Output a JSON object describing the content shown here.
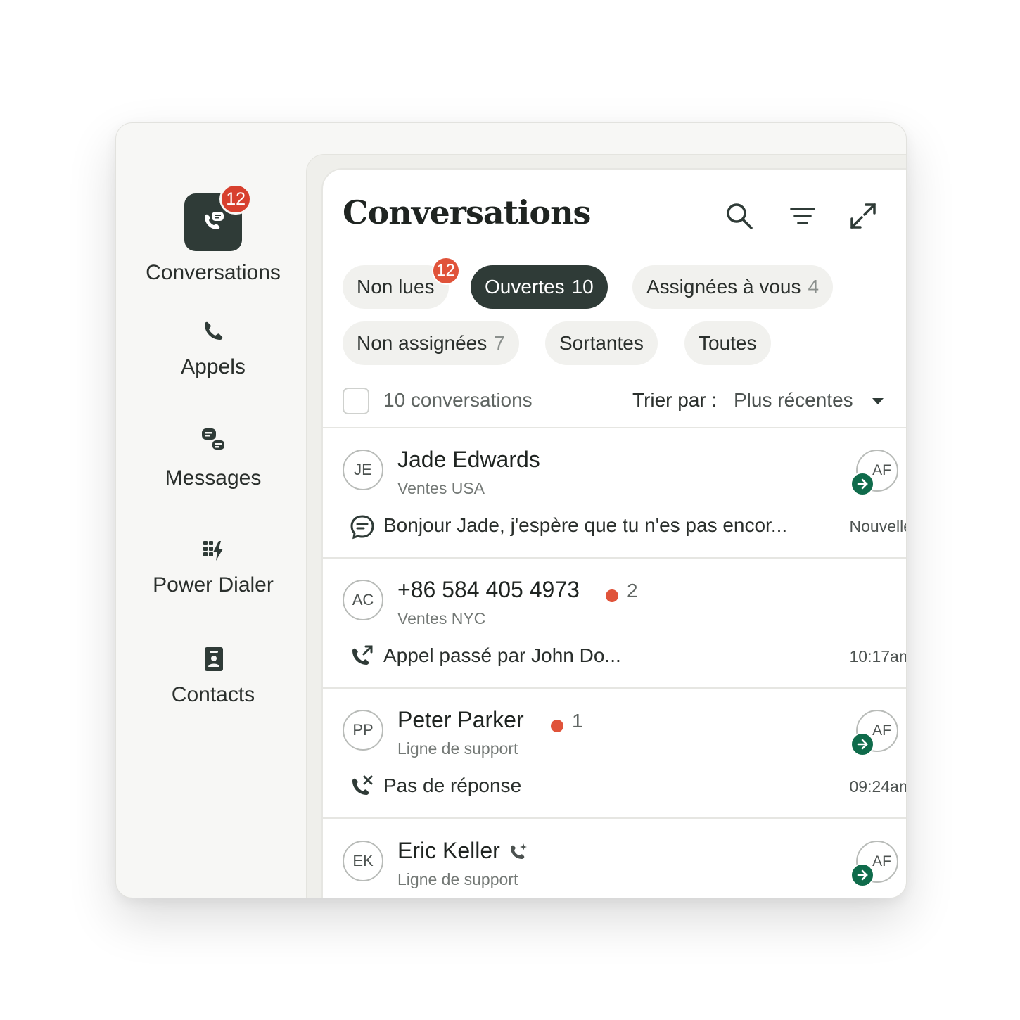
{
  "sidebar": {
    "items": [
      {
        "label": "Conversations",
        "icon": "chat-phone-icon",
        "badge": "12",
        "active": true
      },
      {
        "label": "Appels",
        "icon": "phone-icon"
      },
      {
        "label": "Messages",
        "icon": "messages-icon"
      },
      {
        "label": "Power Dialer",
        "icon": "power-dialer-icon"
      },
      {
        "label": "Contacts",
        "icon": "contacts-icon"
      }
    ]
  },
  "panel": {
    "title": "Conversations",
    "header_icons": [
      "search-icon",
      "filter-icon",
      "expand-icon"
    ]
  },
  "filters": [
    {
      "label": "Non lues",
      "count": "",
      "badge": "12",
      "active": false
    },
    {
      "label": "Ouvertes",
      "count": "10",
      "active": true
    },
    {
      "label": "Assignées à vous",
      "count": "4",
      "active": false
    },
    {
      "label": "Non assignées",
      "count": "7",
      "active": false
    },
    {
      "label": "Sortantes",
      "count": "",
      "active": false
    },
    {
      "label": "Toutes",
      "count": "",
      "active": false
    }
  ],
  "list_header": {
    "count_text": "10 conversations",
    "sort_label": "Trier par :",
    "sort_value": "Plus récentes"
  },
  "conversations": [
    {
      "initials": "JE",
      "name": "Jade Edwards",
      "line": "Ventes USA",
      "preview_icon": "message-bubble-icon",
      "preview": "Bonjour Jade, j'espère que tu n'es pas encor...",
      "time": "Nouvelle",
      "unread": "",
      "assignee": "AF"
    },
    {
      "initials": "AC",
      "name": "+86 584 405 4973",
      "line": "Ventes NYC",
      "preview_icon": "outgoing-call-icon",
      "preview": "Appel passé par John Do...",
      "time": "10:17am",
      "unread": "2",
      "assignee": ""
    },
    {
      "initials": "PP",
      "name": "Peter Parker",
      "line": "Ligne de support",
      "preview_icon": "missed-call-icon",
      "preview": "Pas de réponse",
      "time": "09:24am",
      "unread": "1",
      "assignee": "AF"
    },
    {
      "initials": "EK",
      "name": "Eric Keller",
      "line": "Ligne de support",
      "preview_icon": "",
      "preview": "",
      "time": "",
      "unread": "",
      "assignee": "AF",
      "name_icon": "phone-sparkle-icon"
    }
  ],
  "colors": {
    "accent_dark": "#2f3b37",
    "badge_red": "#e0533a",
    "assign_green": "#0f6b4b"
  }
}
